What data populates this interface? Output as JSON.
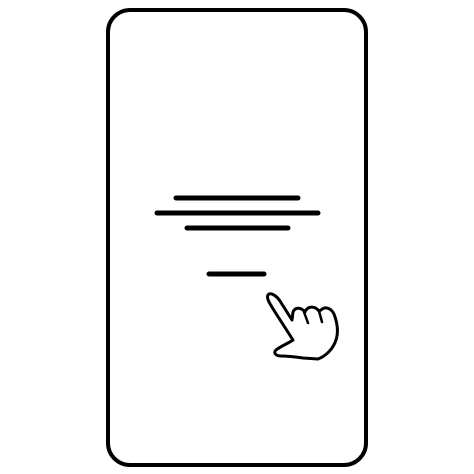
{
  "illustration": {
    "device_icon": "phone-icon",
    "content_icon": "text-lines-icon",
    "action_icon": "tap-hand-icon",
    "stroke_color": "#000000",
    "fill_color": "#ffffff"
  }
}
